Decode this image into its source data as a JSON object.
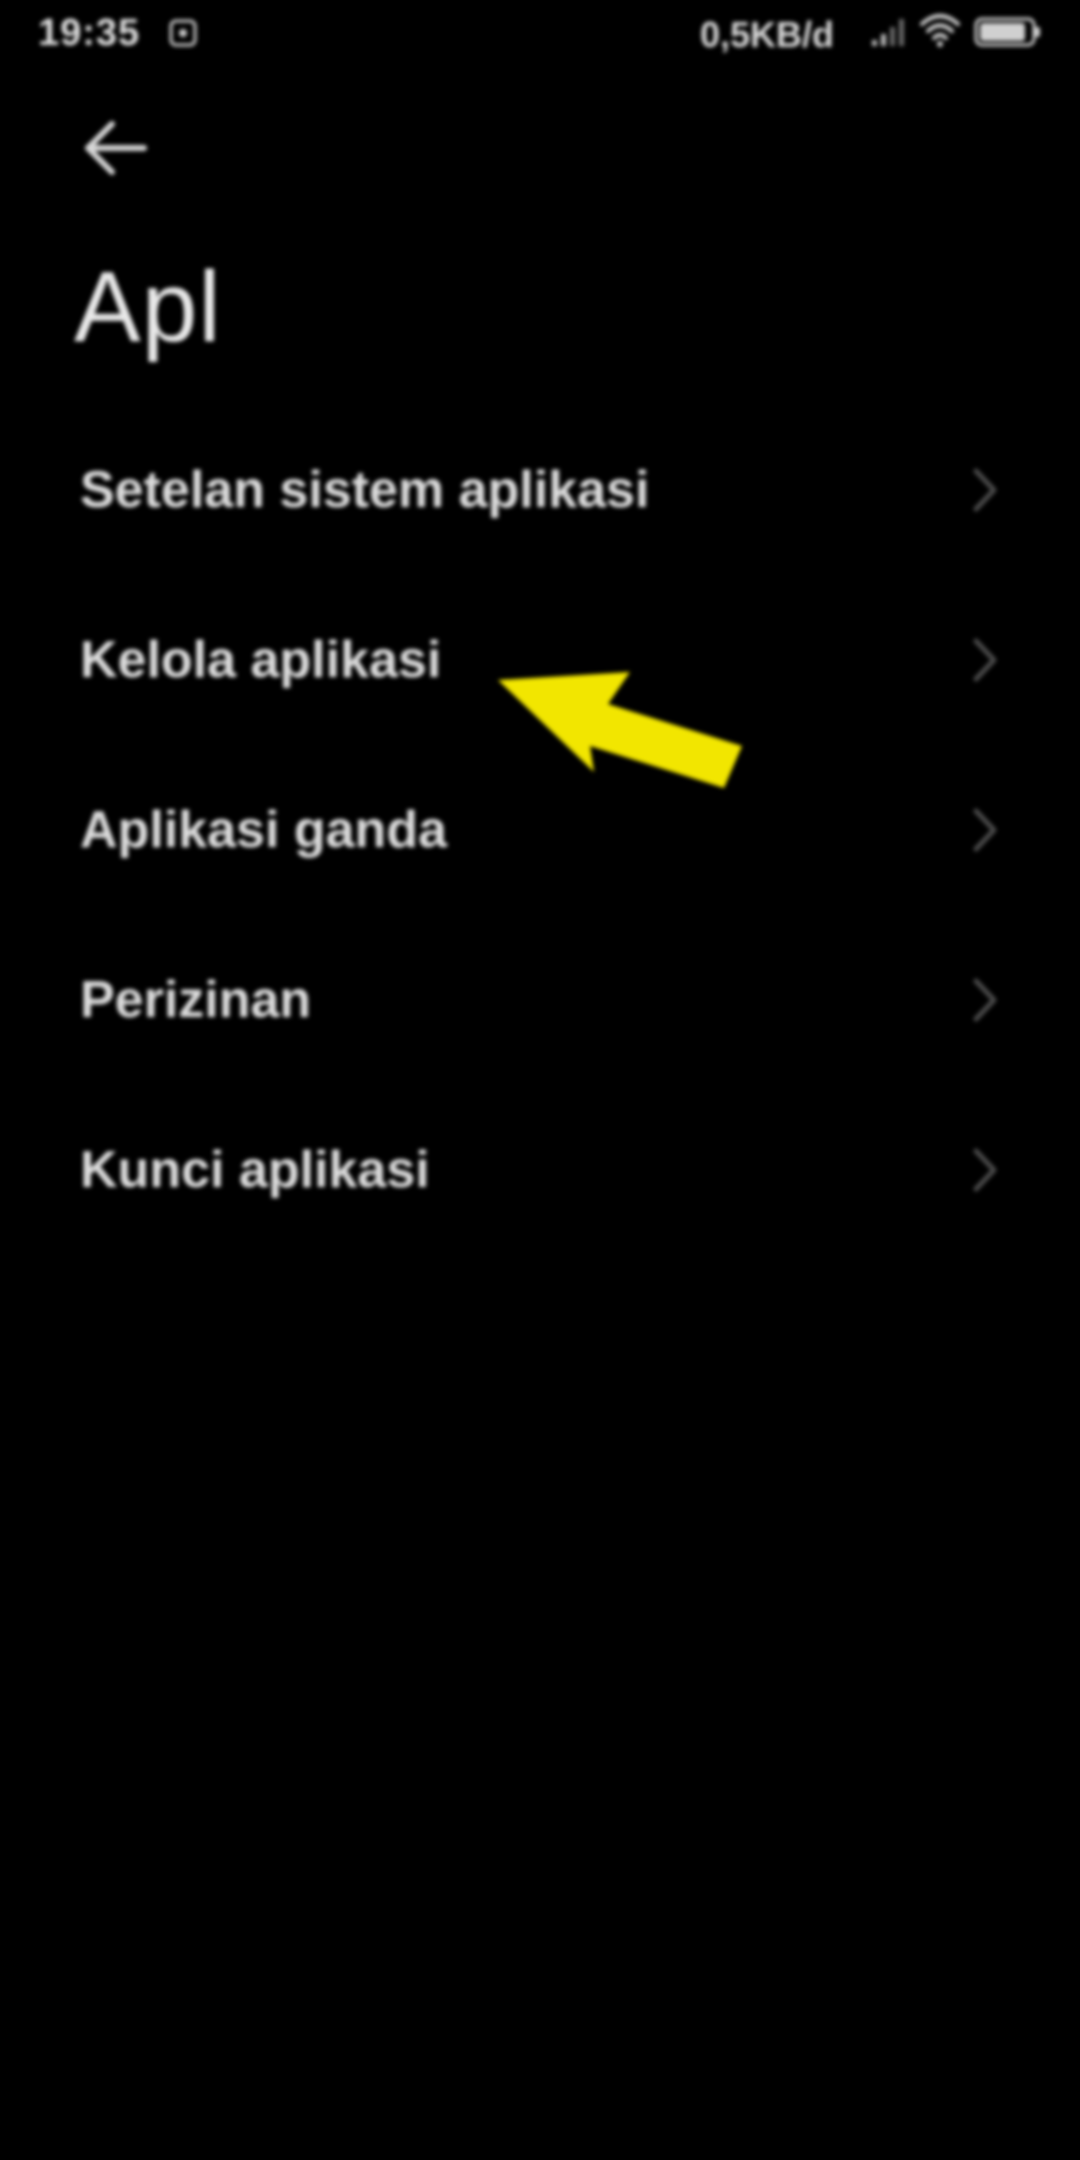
{
  "status_bar": {
    "time": "19:35",
    "network_speed": "0,5KB/d",
    "icons": [
      "notification-icon",
      "signal-icon",
      "wifi-icon",
      "battery-icon"
    ],
    "battery_level": 0.9
  },
  "header": {
    "back_icon": "back-arrow-icon",
    "title": "Apl"
  },
  "menu": {
    "items": [
      {
        "label": "Setelan sistem aplikasi",
        "icon": "chevron-right-icon"
      },
      {
        "label": "Kelola aplikasi",
        "icon": "chevron-right-icon"
      },
      {
        "label": "Aplikasi ganda",
        "icon": "chevron-right-icon"
      },
      {
        "label": "Perizinan",
        "icon": "chevron-right-icon"
      },
      {
        "label": "Kunci aplikasi",
        "icon": "chevron-right-icon"
      }
    ]
  },
  "annotation": {
    "icon": "yellow-arrow-icon",
    "color": "#f2e600",
    "points_to": "Kelola aplikasi"
  },
  "colors": {
    "background": "#000000",
    "text": "#dcdcdc",
    "chevron": "#4a4a4a"
  }
}
